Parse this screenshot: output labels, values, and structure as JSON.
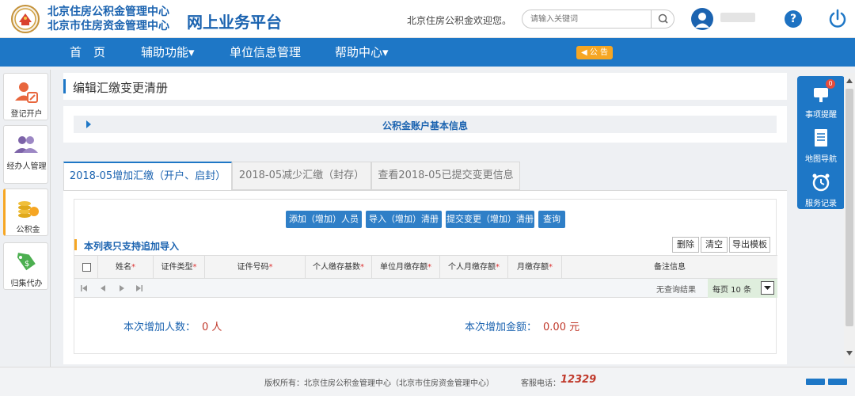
{
  "header": {
    "org_line1": "北京住房公积金管理中心",
    "org_line2": "北京市住房资金管理中心",
    "platform": "网上业务平台",
    "welcome": "北京住房公积金欢迎您。",
    "search_placeholder": "请输入关键词",
    "help_label": "?"
  },
  "nav": {
    "items": [
      "首　页",
      "辅助功能▾",
      "单位信息管理",
      "帮助中心▾"
    ],
    "notice": "◀ 公 告"
  },
  "sidebar": {
    "items": [
      {
        "label": "登记开户"
      },
      {
        "label": "经办人管理"
      },
      {
        "label": "公积金"
      },
      {
        "label": "归集代办"
      }
    ]
  },
  "page": {
    "title": "编辑汇缴变更清册",
    "info_panel": "公积金账户基本信息"
  },
  "tabs": [
    {
      "label": "2018-05增加汇缴（开户、启封）"
    },
    {
      "label": "2018-05减少汇缴（封存）"
    },
    {
      "label": "查看2018-05已提交变更信息"
    }
  ],
  "actions": {
    "add": "添加（增加）人员",
    "import": "导入（增加）清册",
    "submit": "提交变更（增加）清册",
    "query": "查询"
  },
  "grid": {
    "title": "本列表只支持追加导入",
    "buttons": {
      "delete": "删除",
      "clear": "清空",
      "export_template": "导出模板"
    },
    "columns": [
      "姓名",
      "证件类型",
      "证件号码",
      "个人缴存基数",
      "单位月缴存额",
      "个人月缴存额",
      "月缴存额",
      "备注信息"
    ],
    "required_mark": "*",
    "no_result": "无查询结果",
    "page_size_label": "每页 10 条"
  },
  "summary": {
    "count_label": "本次增加人数：",
    "count_value": "0 人",
    "amount_label": "本次增加金额：",
    "amount_value": "0.00 元"
  },
  "right_panel": {
    "items": [
      {
        "label": "事项提醒",
        "badge": "0"
      },
      {
        "label": "地图导航"
      },
      {
        "label": "服务记录"
      }
    ]
  },
  "footer": {
    "copyright": "版权所有：北京住房公积金管理中心（北京市住房资金管理中心）",
    "tel_label": "客服电话：",
    "tel": "12329"
  },
  "colors": {
    "primary": "#1e77c6",
    "title_blue": "#1b63b0",
    "accent": "#f6a623",
    "value_red": "#c0392b"
  }
}
